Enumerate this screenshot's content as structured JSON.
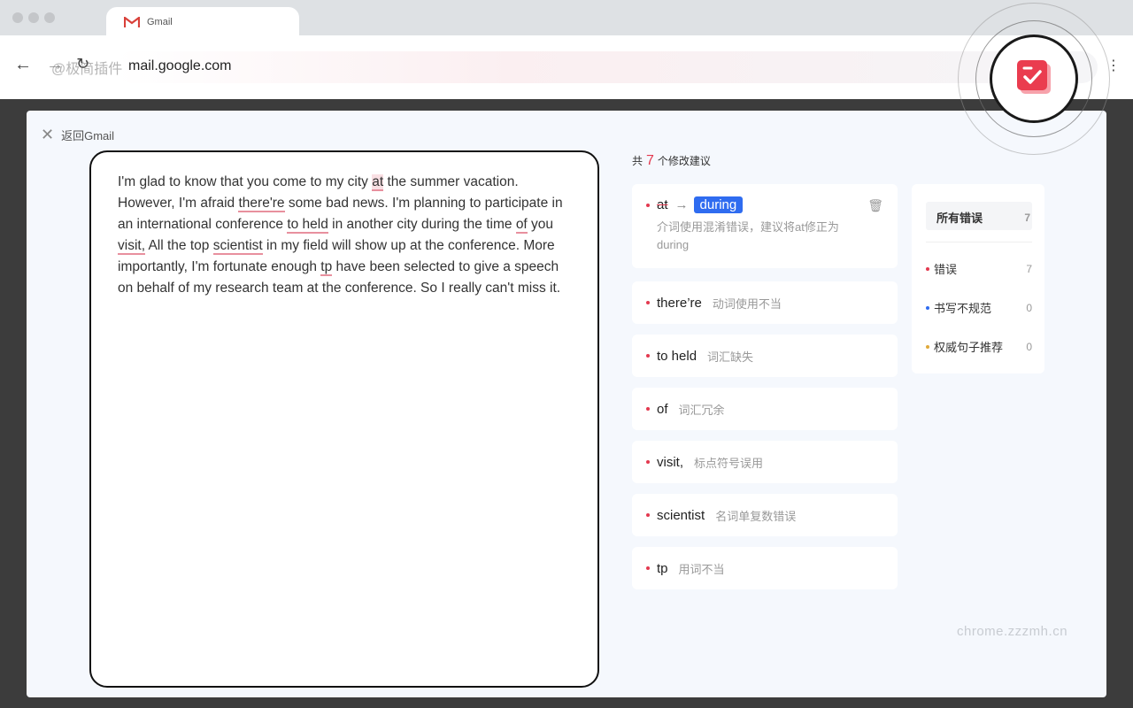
{
  "browser": {
    "tab_title": "Gmail",
    "url": "mail.google.com",
    "watermark": "@极简插件"
  },
  "modal": {
    "back_label": "返回Gmail",
    "editor_text": {
      "segments": [
        {
          "t": "I'm glad to know that you come to my city "
        },
        {
          "t": "at",
          "err": true,
          "hl": true
        },
        {
          "t": " the summer vacation. However, I'm afraid "
        },
        {
          "t": "there're",
          "err": true
        },
        {
          "t": " some bad news. I'm planning to participate in an international conference "
        },
        {
          "t": "to held",
          "err": true
        },
        {
          "t": " in another city during the time "
        },
        {
          "t": "of",
          "err": true
        },
        {
          "t": " you "
        },
        {
          "t": "visit,",
          "err": true
        },
        {
          "t": " All the top "
        },
        {
          "t": "scientist",
          "err": true
        },
        {
          "t": " in my field will show up at the conference. More importantly, I'm fortunate enough "
        },
        {
          "t": "tp",
          "err": true
        },
        {
          "t": " have been selected to give a speech on behalf of my research team at the conference. So I really can't miss it."
        }
      ]
    },
    "summary": {
      "prefix": "共",
      "count": "7",
      "suffix": "个修改建议"
    },
    "suggestions": [
      {
        "word": "at",
        "arrow": "→",
        "replacement": "during",
        "desc": "介词使用混淆错误，建议将at修正为during"
      },
      {
        "word": "there’re",
        "desc": "动词使用不当"
      },
      {
        "word": "to held",
        "desc": "词汇缺失"
      },
      {
        "word": "of",
        "desc": "词汇冗余"
      },
      {
        "word": "visit,",
        "desc": "标点符号误用"
      },
      {
        "word": "scientist",
        "desc": "名词单复数错误"
      },
      {
        "word": "tp",
        "desc": "用词不当"
      }
    ],
    "filters": [
      {
        "label": "所有错误",
        "count": "7"
      },
      {
        "label": "错误",
        "count": "7",
        "color": "#e3394f"
      },
      {
        "label": "书写不规范",
        "count": "0",
        "color": "#2f6cf0"
      },
      {
        "label": "权威句子推荐",
        "count": "0",
        "color": "#e0a93a"
      }
    ]
  },
  "watermark": "chrome.zzzmh.cn",
  "colors": {
    "accent": "#e3394f",
    "suggestion": "#2f6cf0"
  }
}
